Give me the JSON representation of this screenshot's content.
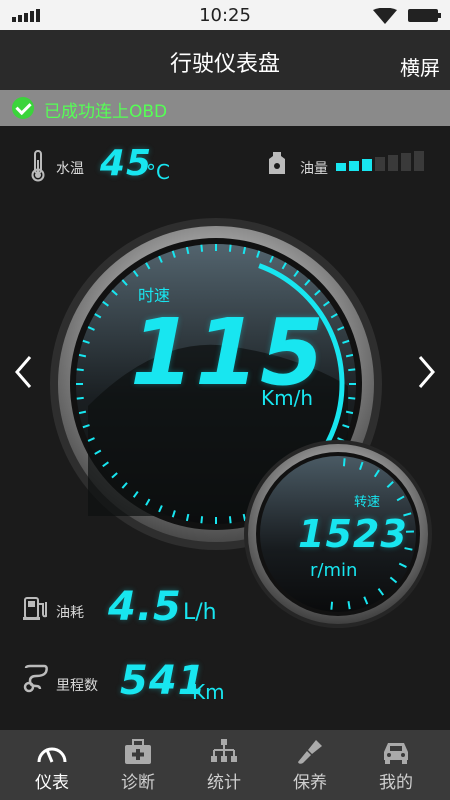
{
  "status_bar": {
    "time": "10:25"
  },
  "header": {
    "title": "行驶仪表盘",
    "landscape_label": "横屏"
  },
  "notice": {
    "text": "已成功连上OBD"
  },
  "water_temp": {
    "label": "水温",
    "value": "45",
    "unit": "°C"
  },
  "fuel_level": {
    "label": "油量",
    "filled_bars": 3,
    "total_bars": 7
  },
  "speed": {
    "label": "时速",
    "value": "115",
    "unit": "Km/h"
  },
  "rpm": {
    "label": "转速",
    "value": "1523",
    "unit": "r/min"
  },
  "fuel_consumption": {
    "label": "油耗",
    "value": "4.5",
    "unit": "L/h"
  },
  "mileage": {
    "label": "里程数",
    "value": "541",
    "unit": "Km"
  },
  "tabs": [
    {
      "label": "仪表",
      "icon": "gauge-icon",
      "active": true
    },
    {
      "label": "诊断",
      "icon": "medkit-icon",
      "active": false
    },
    {
      "label": "统计",
      "icon": "hierarchy-icon",
      "active": false
    },
    {
      "label": "保养",
      "icon": "brush-icon",
      "active": false
    },
    {
      "label": "我的",
      "icon": "car-icon",
      "active": false
    }
  ],
  "colors": {
    "accent": "#18e6f0",
    "success": "#3bd43b",
    "background": "#1b1b1b"
  }
}
